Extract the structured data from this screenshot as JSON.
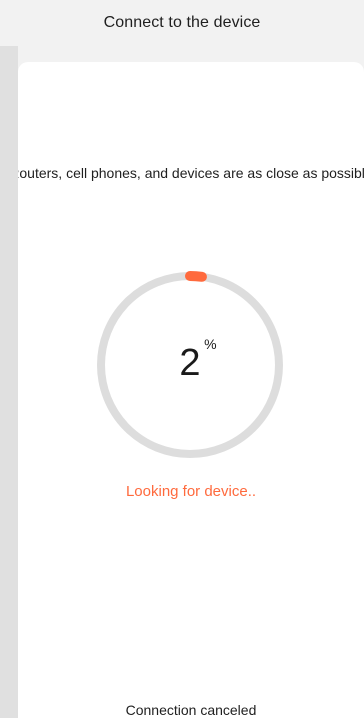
{
  "header": {
    "title": "Connect to the device"
  },
  "content": {
    "hint": "Routers, cell phones, and devices are as close as possible",
    "progress": {
      "value": "2",
      "unit": "%",
      "fraction": 0.02,
      "track_color": "#dddddd",
      "active_color": "#ff6a3d"
    },
    "status": "Looking for device..",
    "cancel_label": "Connection canceled"
  },
  "colors": {
    "background": "#f2f2f2",
    "card": "#ffffff",
    "accent": "#ff6a3d",
    "text": "#1f1f1f"
  }
}
